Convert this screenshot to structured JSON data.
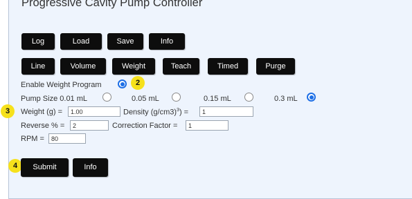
{
  "title": "Progressive Cavity Pump Controller",
  "colors": {
    "button_bg": "#0d0d0d",
    "panel_bg": "#eef4fd",
    "radio_accent": "#1e6fe6",
    "badge": "#f6e11c"
  },
  "toolbar1": {
    "log": "Log",
    "load": "Load",
    "save": "Save",
    "info": "Info"
  },
  "toolbar2": {
    "line": "Line",
    "volume": "Volume",
    "weight": "Weight",
    "teach": "Teach",
    "timed": "Timed",
    "purge": "Purge"
  },
  "enable_weight": {
    "label": "Enable Weight Program",
    "checked": true
  },
  "pump_size": {
    "label": "Pump Size",
    "options": [
      {
        "label": "0.01 mL",
        "checked": false
      },
      {
        "label": "0.05 mL",
        "checked": false
      },
      {
        "label": "0.15 mL",
        "checked": false
      },
      {
        "label": "0.3 mL",
        "checked": true
      }
    ]
  },
  "fields": {
    "weight_label": "Weight (g) =",
    "weight_value": "1.00",
    "density_label_main": "Density (g/cm3)",
    "density_label_sup": "3",
    "density_label_end": ") =",
    "density_value": "1",
    "reverse_label": "Reverse % =",
    "reverse_value": "2",
    "correction_label": "Correction Factor =",
    "correction_value": "1",
    "rpm_label": "RPM =",
    "rpm_value": "80"
  },
  "actions": {
    "submit": "Submit",
    "info": "Info"
  },
  "badges": {
    "b2": "2",
    "b3": "3",
    "b4": "4"
  }
}
